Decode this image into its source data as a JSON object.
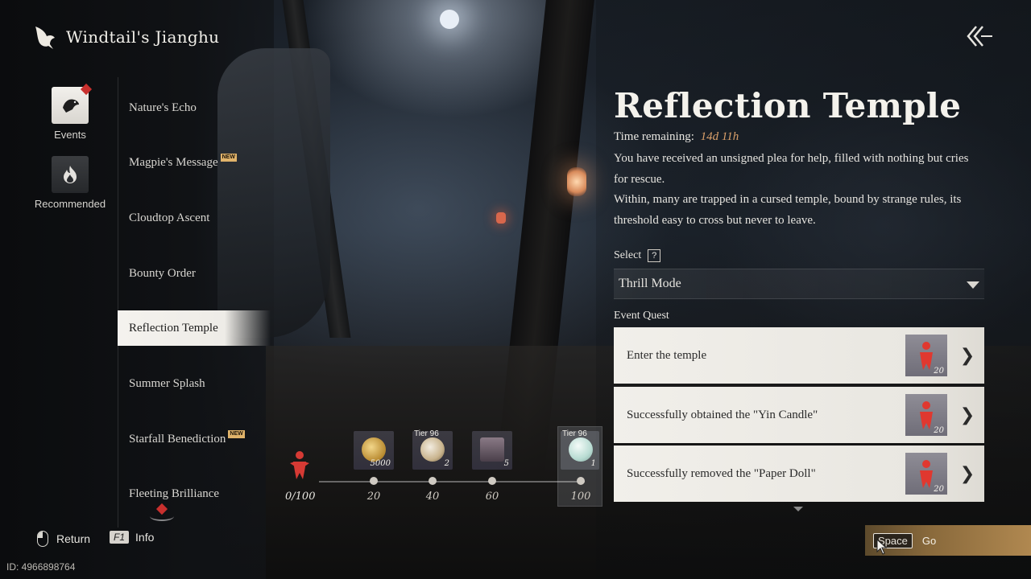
{
  "header": {
    "title": "Windtail's Jianghu"
  },
  "categories": [
    {
      "label": "Events",
      "icon": "magpie-icon"
    },
    {
      "label": "Recommended",
      "icon": "flame-icon"
    }
  ],
  "menu": {
    "items": [
      {
        "label": "Nature's Echo",
        "badge": ""
      },
      {
        "label": "Magpie's Message",
        "badge": "NEW"
      },
      {
        "label": "Cloudtop Ascent",
        "badge": ""
      },
      {
        "label": "Bounty Order",
        "badge": ""
      },
      {
        "label": "Reflection Temple",
        "badge": "",
        "active": true
      },
      {
        "label": "Summer Splash",
        "badge": ""
      },
      {
        "label": "Starfall Benediction",
        "badge": "NEW"
      },
      {
        "label": "Fleeting Brilliance",
        "badge": ""
      }
    ]
  },
  "progress": {
    "count": "0/100",
    "current": 0,
    "max": 100,
    "milestones": [
      "20",
      "40",
      "60",
      "100"
    ],
    "rewards": [
      {
        "amount": "5000",
        "tier": "",
        "icon": "coin-icon"
      },
      {
        "amount": "2",
        "tier": "Tier 96",
        "icon": "ore-icon"
      },
      {
        "amount": "5",
        "tier": "",
        "icon": "chest-icon"
      },
      {
        "amount": "1",
        "tier": "Tier 96",
        "icon": "jade-icon"
      }
    ]
  },
  "detail": {
    "title": "Reflection Temple",
    "time_label": "Time remaining:",
    "time_value": "14d 11h",
    "desc_1": "You have received an unsigned plea for help, filled with nothing but cries for rescue.",
    "desc_2": "Within, many are trapped in a cursed temple, bound by strange rules, its threshold easy to cross but never to leave.",
    "select_label": "Select",
    "help": "?",
    "mode": "Thrill Mode",
    "quest_label": "Event Quest",
    "quests": [
      {
        "text": "Enter the temple",
        "reward": "20"
      },
      {
        "text": "Successfully obtained the \"Yin Candle\"",
        "reward": "20"
      },
      {
        "text": "Successfully removed the \"Paper Doll\"",
        "reward": "20"
      }
    ]
  },
  "footer": {
    "return_label": "Return",
    "info_key": "F1",
    "info_label": "Info",
    "id_text": "ID: 4966898764",
    "go_key": "Space",
    "go_label": "Go"
  },
  "colors": {
    "accent_red": "#c8302e",
    "gold": "#b08850",
    "time": "#d9a06a"
  }
}
